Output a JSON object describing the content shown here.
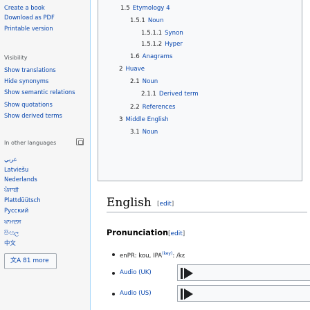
{
  "sidebar": {
    "links_top": [
      "Create a book",
      "Download as PDF",
      "Printable version"
    ],
    "visibility_heading": "Visibility",
    "visibility_items": [
      "Show translations",
      "Hide synonyms",
      "Show semantic relations",
      "Show quotations",
      "Show derived terms"
    ],
    "languages_heading": "In other languages",
    "language_settings_icon": "gear-icon",
    "languages": [
      "عربي",
      "Latviešu",
      "Nederlands",
      "ਪੰਜਾਬੀ",
      "Plattdüütsch",
      "Русский",
      "ਖਾਮਦਸ",
      "සිංහල",
      "中文"
    ],
    "more_languages_label": "文A 81 more"
  },
  "toc": {
    "items": [
      {
        "num": "1.5",
        "label": "Etymology 4"
      },
      {
        "num": "1.5.1",
        "label": "Noun"
      },
      {
        "num": "1.5.1.1",
        "label": "Synon"
      },
      {
        "num": "1.5.1.2",
        "label": "Hyper"
      },
      {
        "num": "1.6",
        "label": "Anagrams"
      },
      {
        "num": "2",
        "label": "Huave"
      },
      {
        "num": "2.1",
        "label": "Noun"
      },
      {
        "num": "2.1.1",
        "label": "Derived term"
      },
      {
        "num": "2.2",
        "label": "References"
      },
      {
        "num": "3",
        "label": "Middle English"
      },
      {
        "num": "3.1",
        "label": "Noun"
      }
    ]
  },
  "content": {
    "english_heading": "English",
    "edit_open": "[",
    "edit_label": "edit",
    "edit_close": "]",
    "pronunciation_heading": "Pronunciation",
    "enpr_text": "enPR: kou, IPA",
    "ipa_key": "(key)",
    "ipa_value": ": /kɛ",
    "audio_uk": "Audio (UK)",
    "audio_us": "Audio (US)"
  },
  "colors": {
    "link": "#0645ad",
    "sidebar_bg": "#f6f6f6",
    "content_border": "#a7d7f9"
  }
}
